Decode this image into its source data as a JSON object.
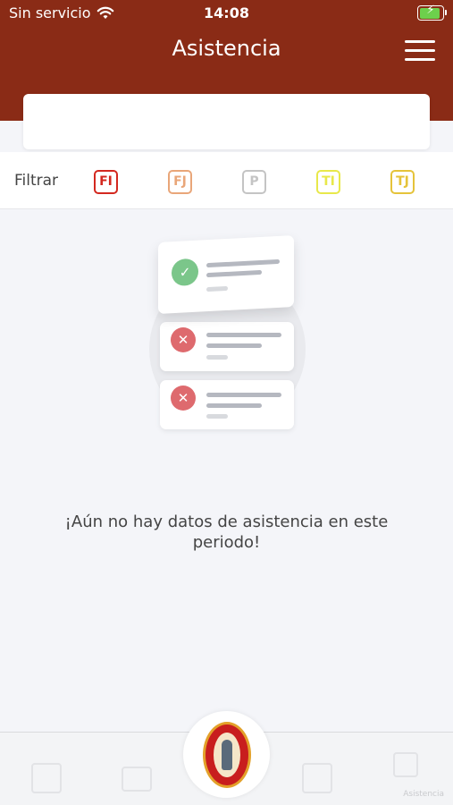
{
  "status_bar": {
    "carrier": "Sin servicio",
    "time": "14:08",
    "battery_fraction": 0.9
  },
  "header": {
    "title": "Asistencia"
  },
  "search": {
    "placeholder": ""
  },
  "filters": {
    "label": "Filtrar",
    "chips": [
      {
        "code": "FI",
        "color": "#d3281f"
      },
      {
        "code": "FJ",
        "color": "#e9a679"
      },
      {
        "code": "P",
        "color": "#c4c4c4"
      },
      {
        "code": "TI",
        "color": "#e8e84a"
      },
      {
        "code": "TJ",
        "color": "#e5c33a"
      }
    ]
  },
  "empty_state": {
    "message": "¡Aún no hay datos de asistencia en este periodo!"
  },
  "colors": {
    "header_bg": "#8a2b16",
    "check": "#7bc68a",
    "cross": "#de6a6e"
  },
  "tabbar": {
    "last_label": "Asistencia"
  }
}
